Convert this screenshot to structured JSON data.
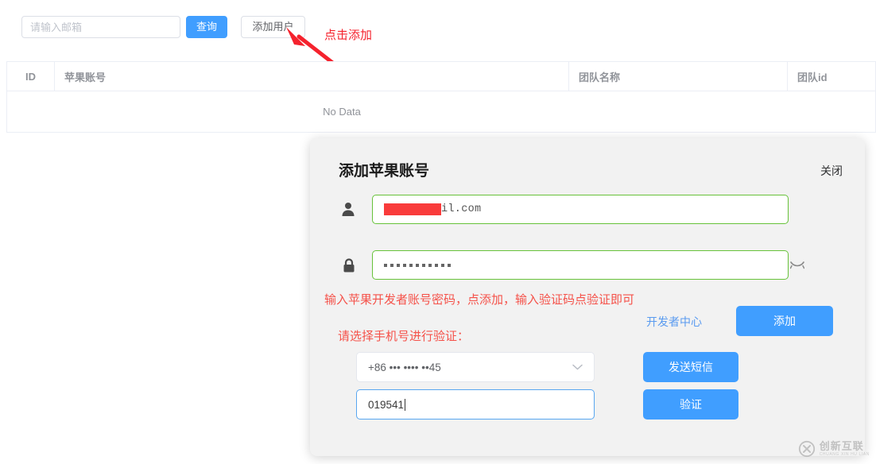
{
  "toolbar": {
    "search_placeholder": "请输入邮箱",
    "search_value": "",
    "query_label": "查询",
    "add_user_label": "添加用户"
  },
  "annotation": {
    "click_add_text": "点击添加",
    "arrow_color": "#f5222d"
  },
  "table": {
    "columns": [
      "ID",
      "苹果账号",
      "团队名称",
      "团队id"
    ],
    "rows": [],
    "empty_text": "No Data"
  },
  "modal": {
    "title": "添加苹果账号",
    "close_label": "关闭",
    "email": {
      "value_tail": "il.com",
      "redacted": true
    },
    "password": {
      "masked_value": "•••••••••••",
      "dot_count": 11,
      "toggle_icon": "eye-closed-icon"
    },
    "hint_primary": "输入苹果开发者账号密码，点添加，输入验证码点验证即可",
    "dev_center_link": "开发者中心",
    "add_button_label": "添加",
    "hint_phone": "请选择手机号进行验证：",
    "phone_select": {
      "value": "+86 ••• •••• ••45",
      "options": [
        "+86 ••• •••• ••45"
      ]
    },
    "code_input": {
      "value": "019541",
      "placeholder": ""
    },
    "send_sms_label": "发送短信",
    "verify_label": "验证"
  },
  "watermark": {
    "cn": "创新互联",
    "en": "CHUANG XIN HU LIAN"
  },
  "colors": {
    "primary_blue": "#409eff",
    "valid_green": "#67c23a",
    "warn_red": "#f5524a",
    "annotation_red": "#f5222d",
    "modal_bg": "#f2f2f2"
  }
}
